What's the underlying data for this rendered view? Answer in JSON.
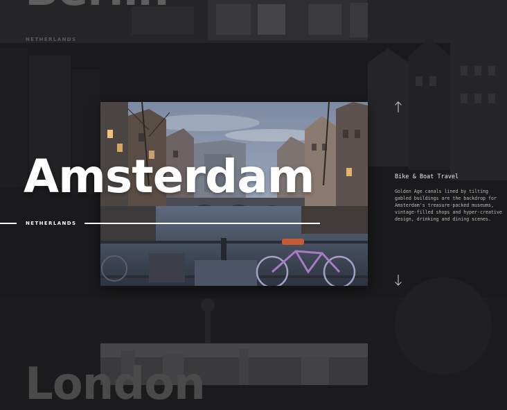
{
  "previous": {
    "title": "Berlin",
    "country": "NETHERLANDS"
  },
  "current": {
    "title": "Amsterdam",
    "country": "NETHERLANDS",
    "heading": "Bike & Boat Travel",
    "description": "Golden Age canals lined by tilting gabled buildings are the backdrop for Amsterdam's treasure-packed museums, vintage-filled shops and hyper-creative design, drinking and dining scenes."
  },
  "next": {
    "title": "London"
  },
  "nav": {
    "up_icon": "arrow-up-icon",
    "down_icon": "arrow-down-icon"
  },
  "colors": {
    "background": "#1b1b1d",
    "text": "#ffffff",
    "muted_text": "#bdbdbd"
  }
}
